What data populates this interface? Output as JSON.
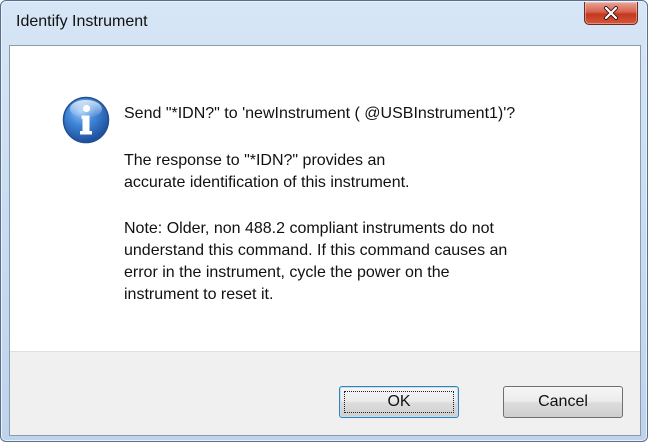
{
  "window": {
    "title": "Identify Instrument",
    "close_symbol": "x"
  },
  "dialog": {
    "icon": "info-icon",
    "message": "Send \"*IDN?\" to 'newInstrument ( @USBInstrument1)'?",
    "description": "The response to \"*IDN?\" provides an\naccurate identification of this instrument.",
    "note": "Note: Older, non 488.2 compliant instruments do not\nunderstand this command. If this command causes an\nerror in the instrument, cycle the power on the\ninstrument to reset it."
  },
  "buttons": {
    "ok_label": "OK",
    "cancel_label": "Cancel"
  },
  "colors": {
    "accent": "#2a6fc4",
    "close_button": "#c2391f"
  }
}
